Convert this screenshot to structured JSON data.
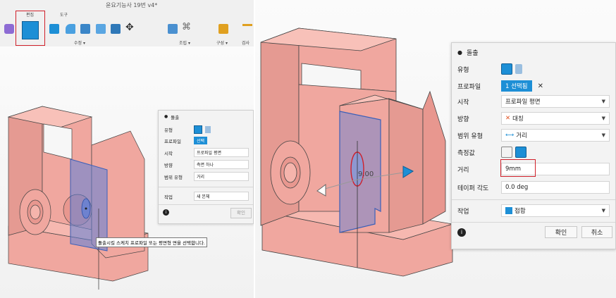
{
  "left": {
    "window_title": "윤요기능사 19번 v4*",
    "toolbar": {
      "tab_edit": "편집",
      "tab_tools": "도구",
      "group_modify": "수정 ▾",
      "group_assemble": "조립 ▾",
      "group_construct": "구성 ▾",
      "group_inspect": "검사"
    },
    "status_hint": "돌출시킬 스케치 프로파일 또는 평면형 면을 선택합니다.",
    "dialog": {
      "title": "돌출",
      "type_label": "유형",
      "profile_label": "프로파일",
      "profile_value": "선택",
      "start_label": "시작",
      "start_value": "프로파일 평면",
      "direction_label": "방향",
      "direction_value": "측면 하나",
      "extent_label": "범위 유형",
      "extent_value": "거리",
      "operation_label": "작업",
      "operation_value": "새 본체",
      "ok_label": "확인",
      "info_icon": "i"
    }
  },
  "right": {
    "dimension_label": "9.00",
    "dialog": {
      "title": "돌출",
      "type_label": "유형",
      "profile_label": "프로파일",
      "profile_value": "1 선택됨",
      "clear_icon": "✕",
      "start_label": "시작",
      "start_value": "프로파일 평면",
      "direction_label": "방향",
      "direction_value": "대칭",
      "extent_label": "범위 유형",
      "extent_value": "거리",
      "measure_label": "측정값",
      "distance_label": "거리",
      "distance_value": "9mm",
      "taper_label": "테이퍼 각도",
      "taper_value": "0.0 deg",
      "operation_label": "작업",
      "operation_value": "접합",
      "ok_label": "확인",
      "cancel_label": "취소",
      "info_icon": "i"
    }
  },
  "colors": {
    "body_fill": "#f0a79f",
    "body_shade": "#d98a82",
    "plane_blue": "#5b7fd8",
    "accent_blue": "#1d8fd6",
    "highlight_red": "#d0202a"
  }
}
